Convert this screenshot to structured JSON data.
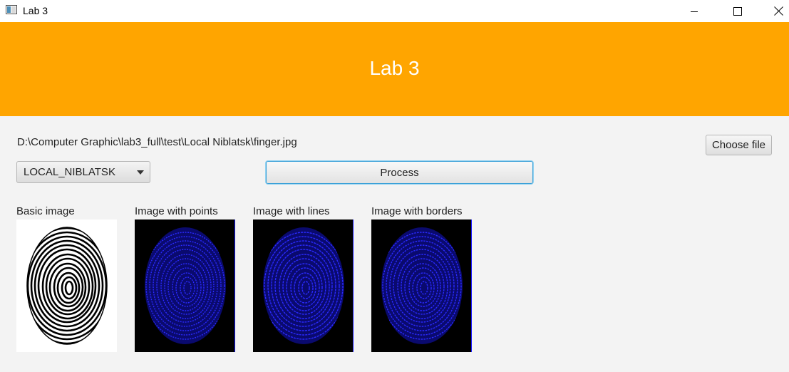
{
  "window": {
    "title": "Lab 3",
    "controls": [
      "minimize-icon",
      "maximize-icon",
      "close-icon"
    ]
  },
  "header": {
    "title": "Lab 3",
    "background_color": "#ffa500"
  },
  "file": {
    "path": "D:\\Computer Graphic\\lab3_full\\test\\Local Niblatsk\\finger.jpg",
    "choose_label": "Choose file"
  },
  "method_select": {
    "value": "LOCAL_NIBLATSK"
  },
  "process": {
    "label": "Process"
  },
  "images": [
    {
      "label": "Basic image",
      "kind": "original fingerprint",
      "colors": [
        "#000000",
        "#ffffff"
      ]
    },
    {
      "label": "Image with points",
      "kind": "processed fingerprint",
      "colors": [
        "#1a1aff",
        "#000000"
      ]
    },
    {
      "label": "Image with lines",
      "kind": "processed fingerprint",
      "colors": [
        "#1a1aff",
        "#000000"
      ]
    },
    {
      "label": "Image with borders",
      "kind": "processed fingerprint",
      "colors": [
        "#1a1aff",
        "#000000"
      ]
    }
  ]
}
